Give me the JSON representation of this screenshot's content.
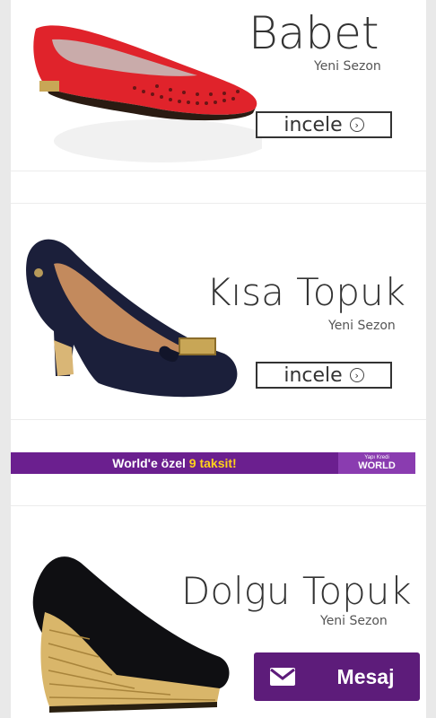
{
  "products": [
    {
      "title": "Babet",
      "subtitle": "Yeni Sezon",
      "button": "incele"
    },
    {
      "title": "Kısa Topuk",
      "subtitle": "Yeni Sezon",
      "button": "incele"
    },
    {
      "title": "Dolgu Topuk",
      "subtitle": "Yeni Sezon"
    }
  ],
  "banner": {
    "text_part1": "World'e özel",
    "text_highlight": "9 taksit!",
    "logo_small": "Yapı Kredi",
    "logo_text": "WORLD"
  },
  "message_button": {
    "label": "Mesaj",
    "icon": "mail-icon"
  },
  "colors": {
    "banner": "#6b1f8f",
    "message": "#5d1c7a",
    "highlight": "#ffd21a",
    "red_shoe": "#e0232b",
    "navy_shoe": "#1b1f3a"
  }
}
